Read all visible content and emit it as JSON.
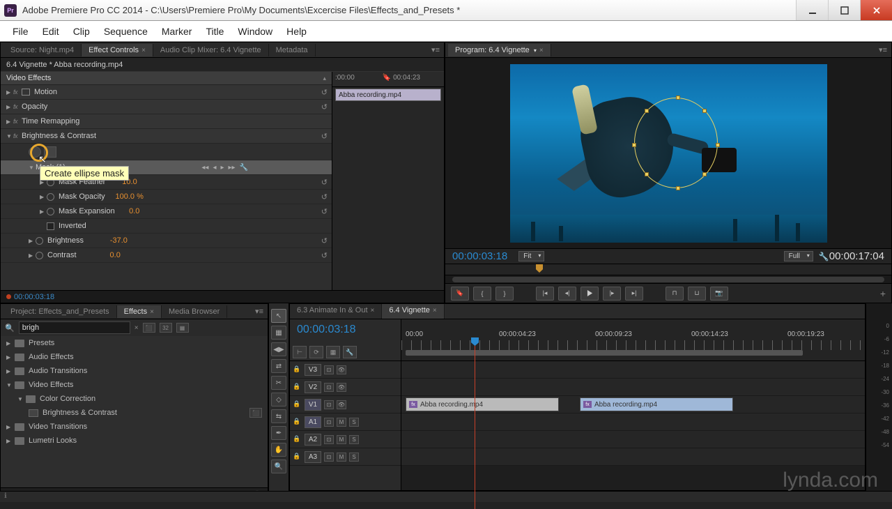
{
  "window": {
    "app_title": "Adobe Premiere Pro CC 2014 - C:\\Users\\Premiere Pro\\My Documents\\Excercise Files\\Effects_and_Presets *",
    "app_abbrev": "Pr"
  },
  "menu": [
    "File",
    "Edit",
    "Clip",
    "Sequence",
    "Marker",
    "Title",
    "Window",
    "Help"
  ],
  "source_tabs": {
    "source": "Source: Night.mp4",
    "effect_controls": "Effect Controls",
    "audio_mixer": "Audio Clip Mixer: 6.4 Vignette",
    "metadata": "Metadata"
  },
  "effect_controls": {
    "title": "6.4 Vignette * Abba recording.mp4",
    "timeline_start": ":00:00",
    "timeline_mark": "00:04:23",
    "clip_name": "Abba recording.mp4",
    "section": "Video Effects",
    "motion": "Motion",
    "opacity": "Opacity",
    "time_remap": "Time Remapping",
    "brightness_contrast": "Brightness & Contrast",
    "tooltip": "Create ellipse mask",
    "mask_name": "Mask (1)",
    "mask_feather": "Mask Feather",
    "mask_feather_val": "10.0",
    "mask_opacity": "Mask Opacity",
    "mask_opacity_val": "100.0 %",
    "mask_expansion": "Mask Expansion",
    "mask_expansion_val": "0.0",
    "inverted": "Inverted",
    "brightness": "Brightness",
    "brightness_val": "-37.0",
    "contrast": "Contrast",
    "contrast_val": "0.0",
    "footer_tc": "00:00:03:18"
  },
  "program": {
    "tab": "Program: 6.4 Vignette",
    "tc_left": "00:00:03:18",
    "tc_right": "00:00:17:04",
    "fit": "Fit",
    "full": "Full"
  },
  "effects_browser": {
    "tabs": {
      "project": "Project: Effects_and_Presets",
      "effects": "Effects",
      "media": "Media Browser"
    },
    "search": "brigh",
    "folders": {
      "presets": "Presets",
      "audio_effects": "Audio Effects",
      "audio_transitions": "Audio Transitions",
      "video_effects": "Video Effects",
      "color_correction": "Color Correction",
      "brightness_contrast": "Brightness & Contrast",
      "video_transitions": "Video Transitions",
      "lumetri": "Lumetri Looks"
    }
  },
  "timeline": {
    "tabs": {
      "prev": "6.3 Animate In & Out",
      "current": "6.4 Vignette"
    },
    "tc": "00:00:03:18",
    "marks": [
      "00:00",
      "00:00:04:23",
      "00:00:09:23",
      "00:00:14:23",
      "00:00:19:23"
    ],
    "tracks": {
      "v3": "V3",
      "v2": "V2",
      "v1": "V1",
      "a1": "A1",
      "a2": "A2",
      "a3": "A3"
    },
    "ms": {
      "m": "M",
      "s": "S"
    },
    "clip1": "Abba recording.mp4",
    "clip2": "Abba recording.mp4"
  },
  "meters": [
    "0",
    "-6",
    "-12",
    "-18",
    "-24",
    "-30",
    "-36",
    "-42",
    "-48",
    "-54"
  ],
  "watermark": "lynda.com"
}
